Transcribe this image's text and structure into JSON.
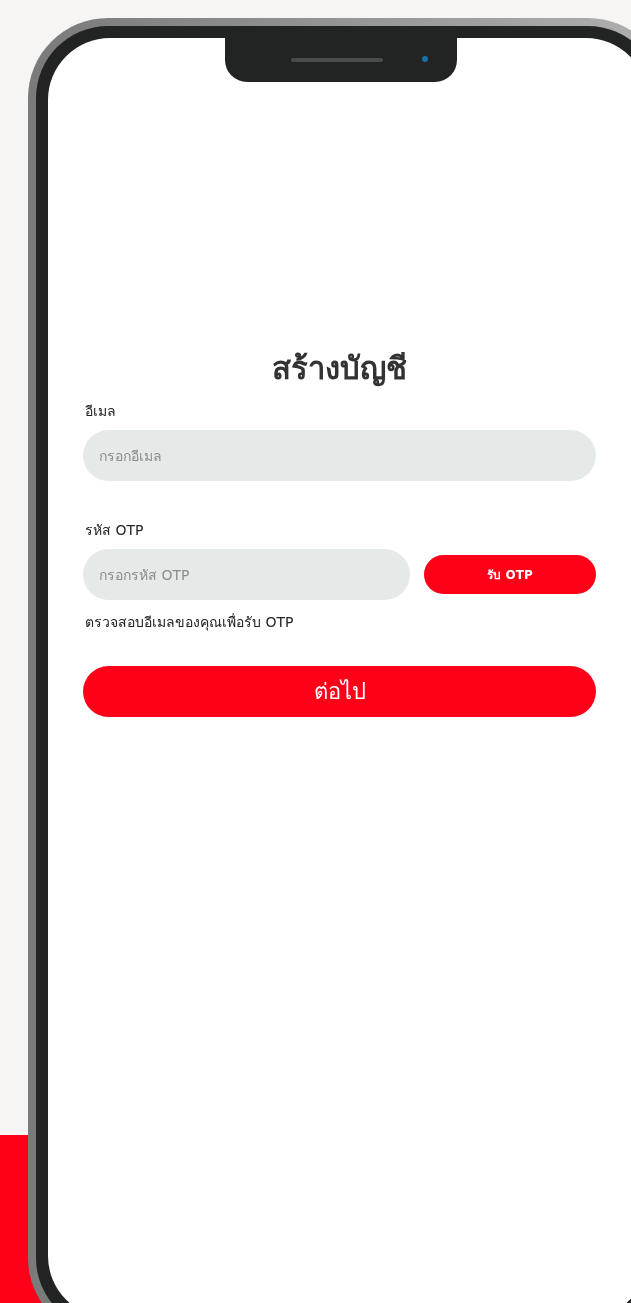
{
  "screen": {
    "title": "สร้างบัญชี",
    "fields": [
      {
        "label": "อีเมล",
        "placeholder": "กรอกอีเมล"
      },
      {
        "label": "รหัส OTP",
        "placeholder": "กรอกรหัส OTP",
        "button": "รับ OTP",
        "hint": "ตรวจสอบอีเมลของคุณเพื่อรับ OTP"
      }
    ],
    "submit": "ต่อไป"
  }
}
